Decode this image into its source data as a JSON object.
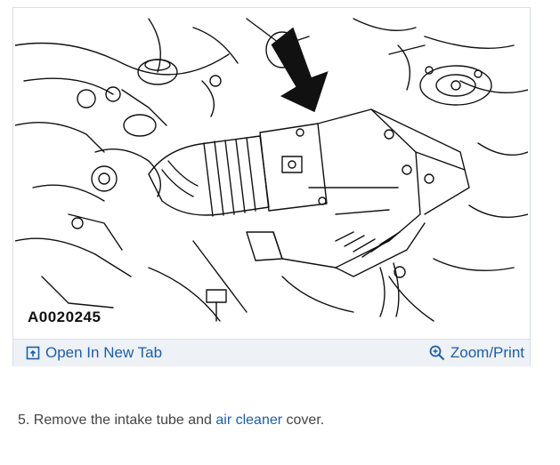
{
  "figure": {
    "code": "A0020245",
    "icon": "engine-air-intake-diagram"
  },
  "toolbar": {
    "open_tab_label": "Open In New Tab",
    "open_tab_icon": "open-new-tab-icon",
    "zoom_label": "Zoom/Print",
    "zoom_icon": "zoom-icon"
  },
  "caption": {
    "before": "5. Remove the intake tube and ",
    "link": "air cleaner",
    "after": " cover."
  },
  "colors": {
    "link": "#1c5fa8",
    "toolbar_bg": "#eef1f5",
    "border": "#d9dde3",
    "caption_text": "#444444"
  }
}
